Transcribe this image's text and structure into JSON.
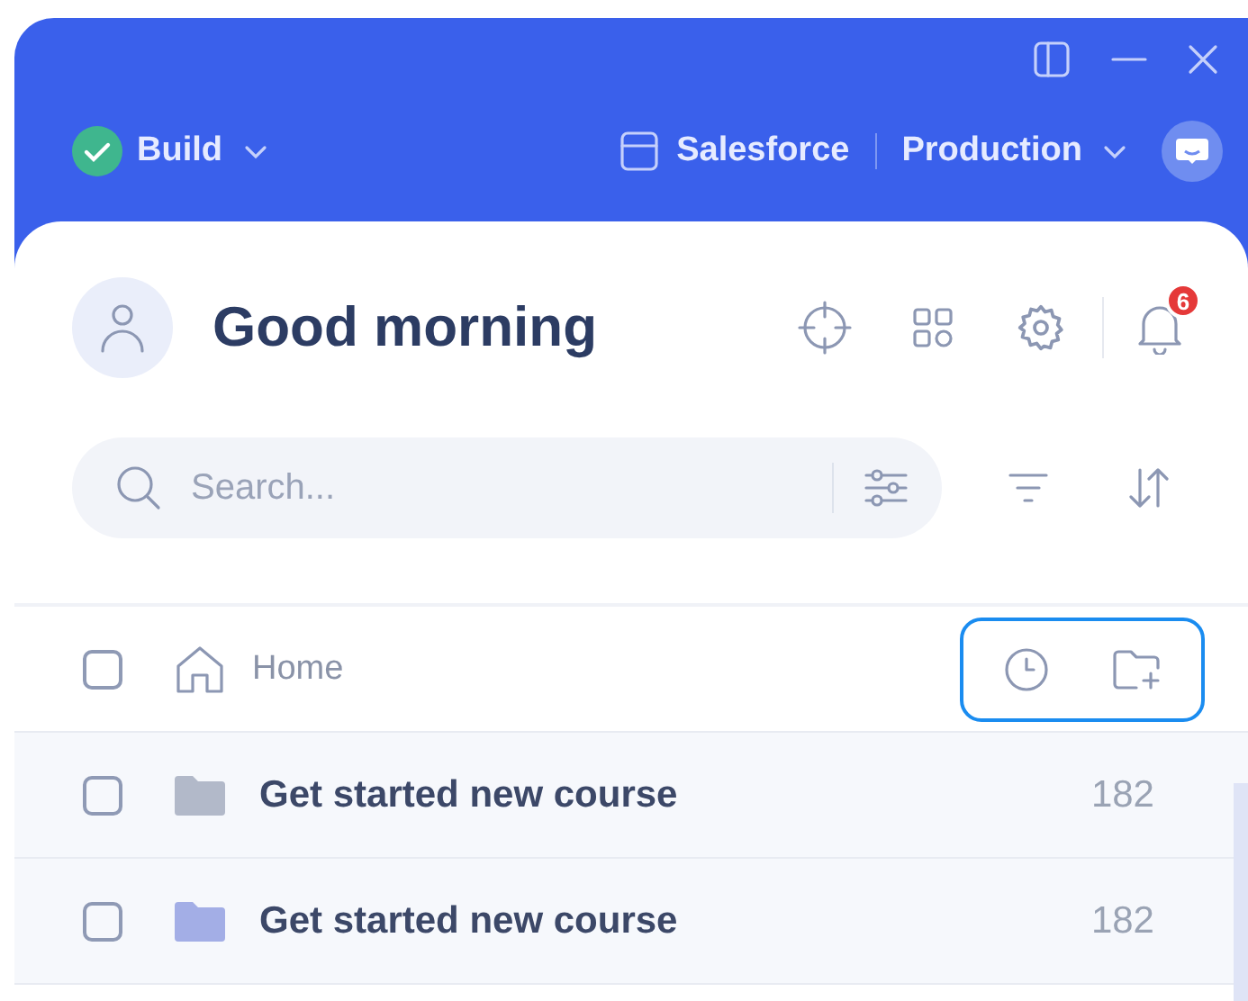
{
  "header": {
    "status": "Build",
    "system": "Salesforce",
    "environment": "Production"
  },
  "greeting": "Good morning",
  "notifications": {
    "count": "6"
  },
  "search": {
    "placeholder": "Search..."
  },
  "breadcrumb": {
    "label": "Home",
    "checked": false
  },
  "rows": [
    {
      "name": "Get started new course",
      "count": "182",
      "checked": false,
      "color": "#b2b9c9"
    },
    {
      "name": "Get started new course",
      "count": "182",
      "checked": false,
      "color": "#a3aee6"
    }
  ]
}
